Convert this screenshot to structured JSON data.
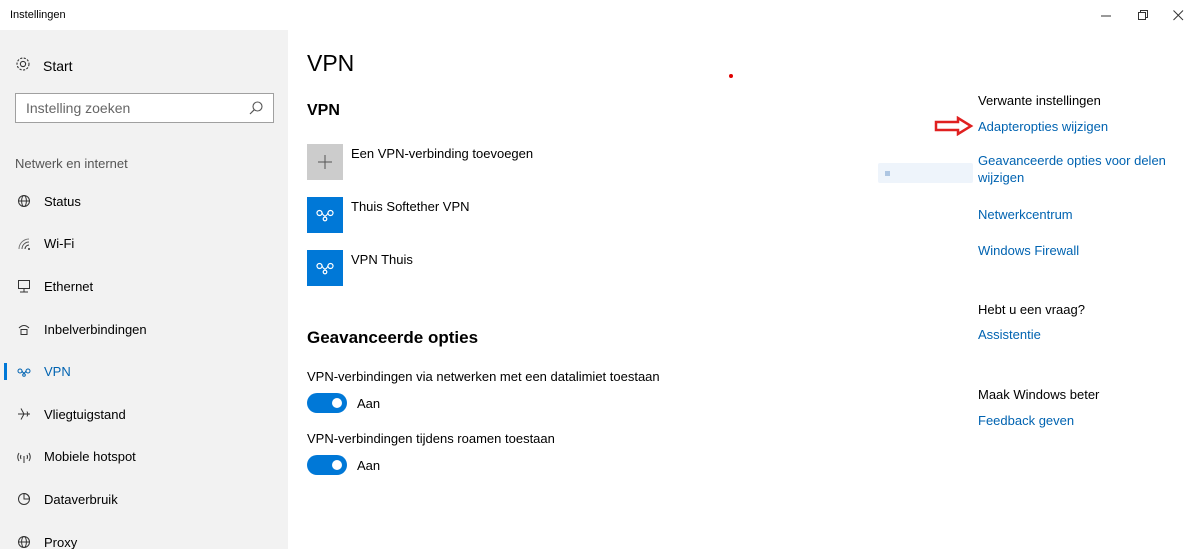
{
  "window": {
    "title": "Instellingen",
    "controls": {
      "minimize": "—",
      "maximize": "❐",
      "close": "✕"
    }
  },
  "sidebar": {
    "home": {
      "label": "Start",
      "icon": "gear-icon"
    },
    "search": {
      "placeholder": "Instelling zoeken",
      "value": "",
      "icon": "search-icon"
    },
    "group_label": "Netwerk en internet",
    "items": [
      {
        "label": "Status",
        "icon": "globe-icon",
        "glyph": "⊕"
      },
      {
        "label": "Wi-Fi",
        "icon": "wifi-icon",
        "glyph": ""
      },
      {
        "label": "Ethernet",
        "icon": "ethernet-icon",
        "glyph": ""
      },
      {
        "label": "Inbelverbindingen",
        "icon": "dialup-icon",
        "glyph": ""
      },
      {
        "label": "VPN",
        "icon": "vpn-icon",
        "glyph": "",
        "active": true
      },
      {
        "label": "Vliegtuigstand",
        "icon": "airplane-icon",
        "glyph": "✈"
      },
      {
        "label": "Mobiele hotspot",
        "icon": "hotspot-icon",
        "glyph": "((·))"
      },
      {
        "label": "Dataverbruik",
        "icon": "data-usage-icon",
        "glyph": "◔"
      },
      {
        "label": "Proxy",
        "icon": "proxy-globe-icon",
        "glyph": "⊕"
      }
    ]
  },
  "main": {
    "page_title": "VPN",
    "section_title": "VPN",
    "add_vpn": {
      "label": "Een VPN-verbinding toevoegen",
      "glyph": "+"
    },
    "connections": [
      {
        "name": "Thuis Softether VPN",
        "icon": "vpn-connection-icon"
      },
      {
        "name": "VPN Thuis",
        "icon": "vpn-connection-icon"
      }
    ],
    "advanced": {
      "title": "Geavanceerde opties",
      "options": [
        {
          "label": "VPN-verbindingen via netwerken met een datalimiet toestaan",
          "state": "Aan",
          "on": true
        },
        {
          "label": "VPN-verbindingen tijdens roamen toestaan",
          "state": "Aan",
          "on": true
        }
      ]
    }
  },
  "related": {
    "heading": "Verwante instellingen",
    "links": [
      "Adapteropties wijzigen",
      "Geavanceerde opties voor delen wijzigen",
      "Netwerkcentrum",
      "Windows Firewall"
    ],
    "question_heading": "Hebt u een vraag?",
    "question_link": "Assistentie",
    "improve_heading": "Maak Windows beter",
    "improve_link": "Feedback geven"
  },
  "colors": {
    "accent": "#0078d7",
    "link": "#0063b1",
    "annotation_arrow": "#e02020",
    "sidebar_bg": "#f2f2f2"
  }
}
